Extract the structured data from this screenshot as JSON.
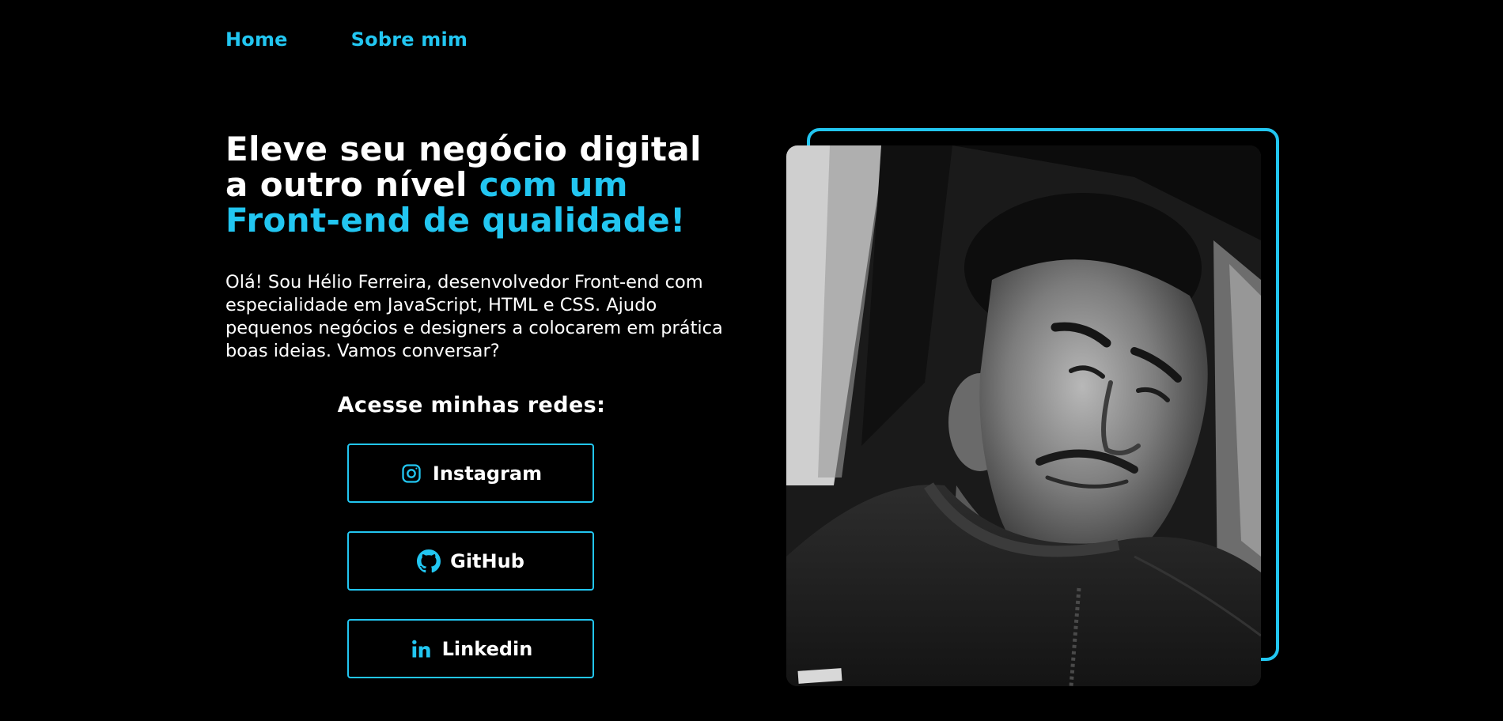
{
  "nav": {
    "home": "Home",
    "about": "Sobre mim"
  },
  "hero": {
    "headline_part1": "Eleve seu negócio digital a outro nível ",
    "headline_accent": "com um Front-end de qualidade!",
    "intro": "Olá! Sou Hélio Ferreira, desenvolvedor Front-end com especialidade em JavaScript, HTML e CSS. Ajudo pequenos negócios e designers a colocarem em prática boas ideias. Vamos conversar?"
  },
  "socials": {
    "title": "Acesse minhas redes:",
    "instagram": "Instagram",
    "github": "GitHub",
    "linkedin": "Linkedin"
  },
  "icons": {
    "instagram": "instagram-icon",
    "github": "github-icon",
    "linkedin": "linkedin-icon"
  },
  "colors": {
    "accent": "#22c6f1",
    "background": "#000000",
    "text": "#ffffff"
  }
}
